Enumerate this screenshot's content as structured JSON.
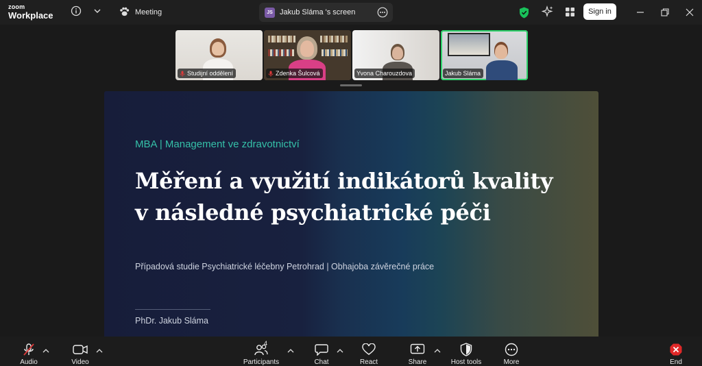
{
  "topbar": {
    "logo_line1": "zoom",
    "logo_line2": "Workplace",
    "meeting_tab": "Meeting",
    "share_tab": {
      "initials": "JS",
      "label": "Jakub Sláma 's screen"
    },
    "signin_label": "Sign in"
  },
  "participants_strip": [
    {
      "name": "Studijní oddělení",
      "muted": true
    },
    {
      "name": "Zdenka Šulcová",
      "muted": true
    },
    {
      "name": "Yvona Charouzdova",
      "muted": false
    },
    {
      "name": "Jakub Sláma",
      "muted": false,
      "active_speaker": true
    }
  ],
  "slide": {
    "subtitle": "MBA | Management ve zdravotnictví",
    "title_line1": "Měření a využití indikátorů kvality",
    "title_line2": "v následné psychiatrické péči",
    "description": "Případová studie Psychiatrické léčebny Petrohrad | Obhajoba závěrečné práce",
    "author": "PhDr. Jakub Sláma"
  },
  "toolbar": {
    "audio": "Audio",
    "video": "Video",
    "participants": "Participants",
    "participants_count": "4",
    "chat": "Chat",
    "react": "React",
    "share": "Share",
    "host_tools": "Host tools",
    "more": "More",
    "end": "End"
  },
  "colors": {
    "active_speaker_border": "#2fd36c",
    "slide_subtitle": "#35c0a8",
    "end_red": "#e02828",
    "muted_red": "#e03a3a",
    "security_green": "#19c15a"
  }
}
